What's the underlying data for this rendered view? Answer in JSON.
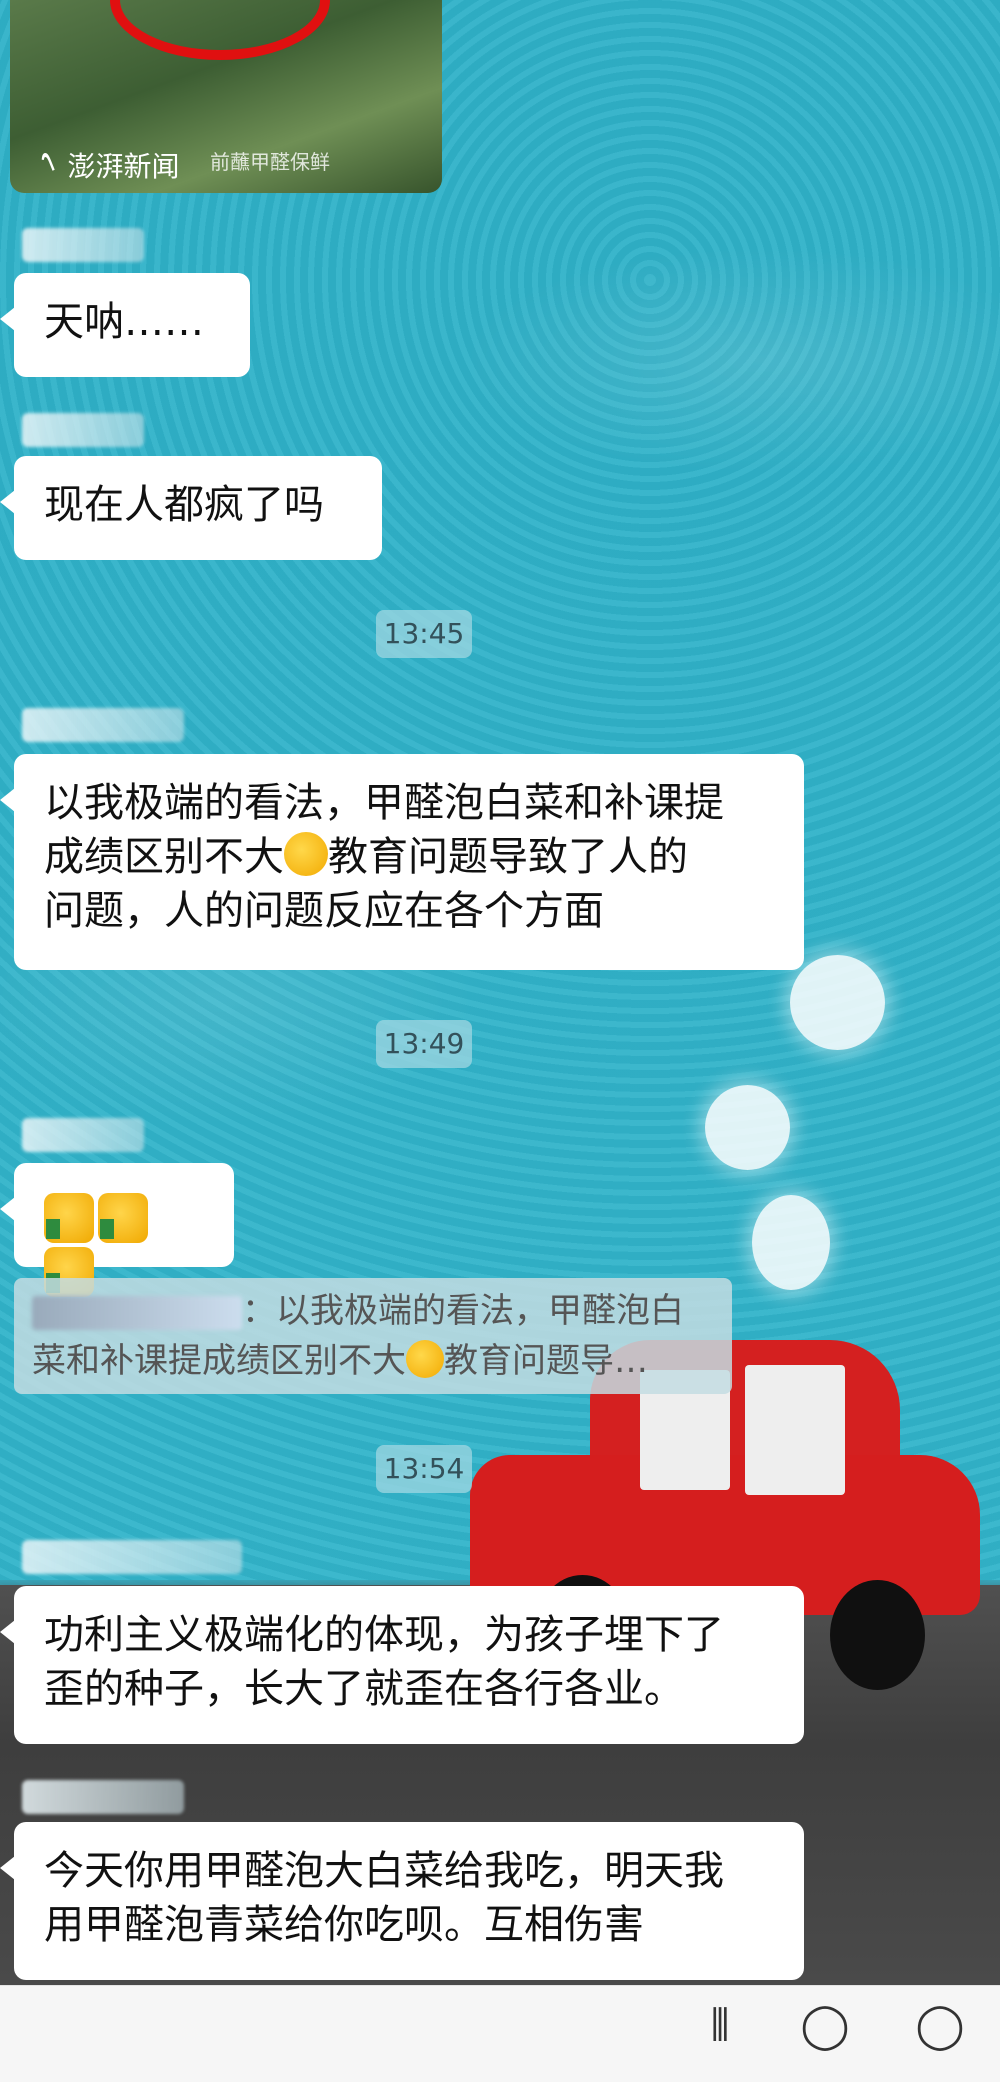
{
  "news_card": {
    "brand_logo": "wave-logo",
    "brand_name": "澎湃新闻",
    "caption": "前蘸甲醛保鲜"
  },
  "messages": [
    {
      "text": "天呐……"
    },
    {
      "text": "现在人都疯了吗"
    },
    {
      "line1": "以我极端的看法，甲醛泡白菜和补课提",
      "line2a": "成绩区别不大",
      "line2b": "教育问题导致了人的",
      "line3": "问题，人的问题反应在各个方面"
    },
    {
      "emoji": "thumbs-up-x3"
    },
    {
      "line1": "功利主义极端化的体现，为孩子埋下了",
      "line2": "歪的种子，长大了就歪在各行各业。"
    },
    {
      "line1": "今天你用甲醛泡大白菜给我吃，明天我",
      "line2": "用甲醛泡青菜给你吃呗。互相伤害"
    }
  ],
  "quote": {
    "line1": "：以我极端的看法，甲醛泡白",
    "line2a": "菜和补课提成绩区别不大",
    "line2b": "教育问题导…"
  },
  "timestamps": [
    "13:45",
    "13:49",
    "13:54"
  ],
  "colors": {
    "wallpaper": "#33b5cb",
    "bubble": "#ffffff",
    "car": "#d51e1e"
  }
}
